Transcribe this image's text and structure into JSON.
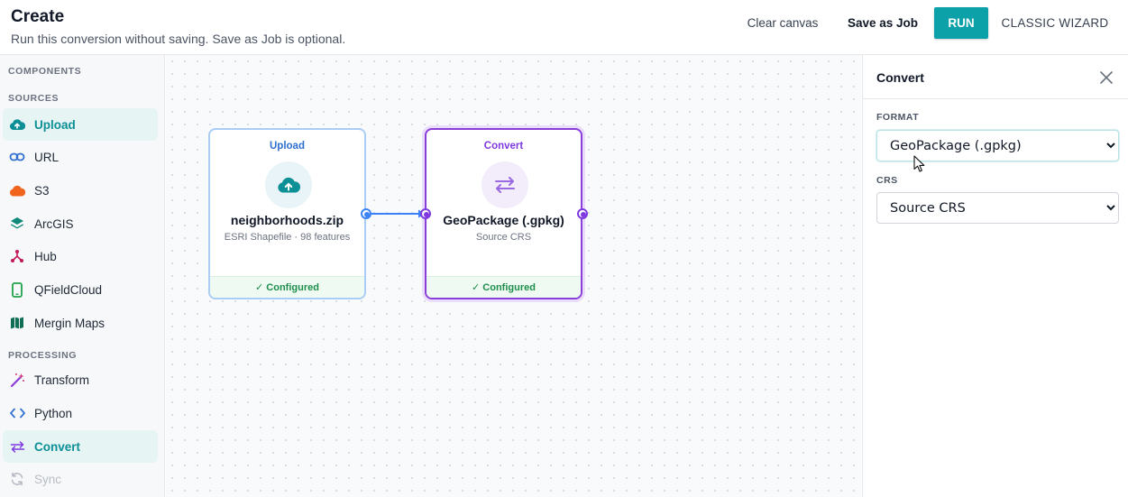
{
  "header": {
    "title": "Create",
    "subtitle": "Run this conversion without saving. Save as Job is optional.",
    "clear_label": "Clear canvas",
    "save_label": "Save as Job",
    "run_label": "RUN",
    "classic_label": "CLASSIC WIZARD"
  },
  "sidebar": {
    "components_label": "COMPONENTS",
    "sources_label": "SOURCES",
    "processing_label": "PROCESSING",
    "sources": [
      {
        "label": "Upload",
        "icon": "cloud-upload-icon",
        "active": true
      },
      {
        "label": "URL",
        "icon": "link-icon"
      },
      {
        "label": "S3",
        "icon": "cloud-icon"
      },
      {
        "label": "ArcGIS",
        "icon": "layers-icon"
      },
      {
        "label": "Hub",
        "icon": "hub-icon"
      },
      {
        "label": "QFieldCloud",
        "icon": "mobile-icon"
      },
      {
        "label": "Mergin Maps",
        "icon": "map-icon"
      }
    ],
    "processing": [
      {
        "label": "Transform",
        "icon": "magic-wand-icon"
      },
      {
        "label": "Python",
        "icon": "code-icon"
      },
      {
        "label": "Convert",
        "icon": "swap-icon",
        "active": true
      },
      {
        "label": "Sync",
        "icon": "sync-icon",
        "disabled": true
      }
    ]
  },
  "canvas": {
    "nodes": [
      {
        "kind": "Upload",
        "name": "neighborhoods.zip",
        "meta": "ESRI Shapefile · 98 features",
        "status": "✓ Configured"
      },
      {
        "kind": "Convert",
        "name": "GeoPackage (.gpkg)",
        "meta": "Source CRS",
        "status": "✓ Configured"
      }
    ]
  },
  "panel": {
    "title": "Convert",
    "format_label": "FORMAT",
    "format_value": "GeoPackage (.gpkg)",
    "crs_label": "CRS",
    "crs_value": "Source CRS"
  },
  "colors": {
    "accent": "#0ca1a8",
    "upload_border": "#a9cdf5",
    "convert_border": "#8b3fd9",
    "configured_green": "#1e8e4b"
  }
}
